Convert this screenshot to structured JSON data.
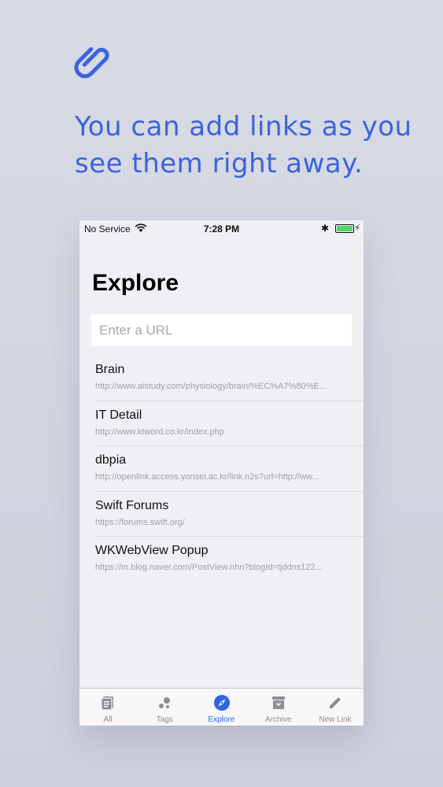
{
  "promo": {
    "icon": "paperclip-icon",
    "headline": "You can add links as you see them right away."
  },
  "status_bar": {
    "carrier": "No Service",
    "time": "7:28 PM",
    "battery_level": 1.0
  },
  "screen": {
    "title": "Explore",
    "url_placeholder": "Enter a URL",
    "links": [
      {
        "title": "Brain",
        "url": "http://www.aistudy.com/physiology/brain/%EC%A7%80%E..."
      },
      {
        "title": "IT Detail",
        "url": "http://www.ktword.co.kr/index.php"
      },
      {
        "title": "dbpia",
        "url": "http://openlink.access.yonsei.ac.kr/link.n2s?url=http://ww..."
      },
      {
        "title": "Swift Forums",
        "url": "https://forums.swift.org/"
      },
      {
        "title": "WKWebView Popup",
        "url": "https://m.blog.naver.com/PostView.nhn?blogId=tjddns122..."
      }
    ]
  },
  "tabbar": {
    "tabs": [
      {
        "label": "All",
        "icon": "list-icon",
        "active": false
      },
      {
        "label": "Tags",
        "icon": "tags-icon",
        "active": false
      },
      {
        "label": "Explore",
        "icon": "compass-icon",
        "active": true
      },
      {
        "label": "Archive",
        "icon": "archive-icon",
        "active": false
      },
      {
        "label": "New Link",
        "icon": "pencil-icon",
        "active": false
      }
    ]
  },
  "colors": {
    "accent": "#3a63e0",
    "tab_active": "#2f64e6",
    "tab_inactive": "#8e8e93",
    "background": "#d3d6e0"
  }
}
